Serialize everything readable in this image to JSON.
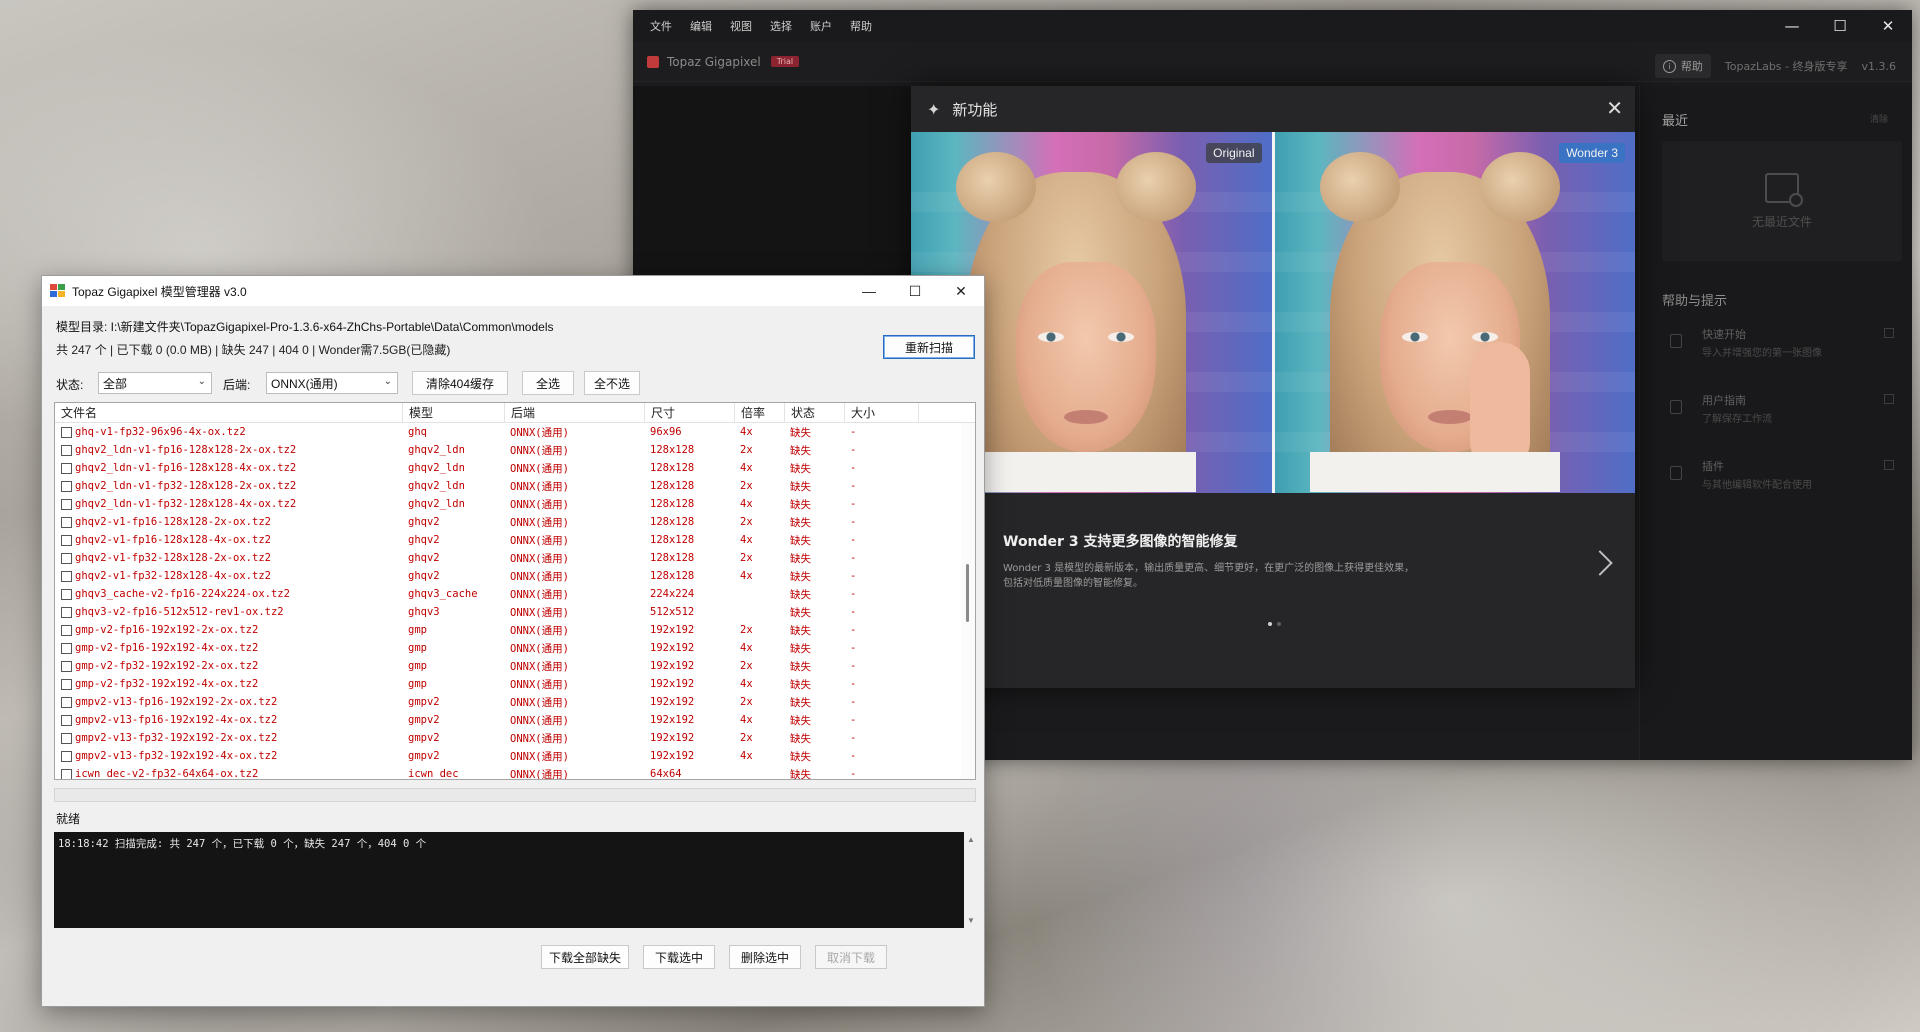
{
  "topaz": {
    "menu": [
      "文件",
      "编辑",
      "视图",
      "选择",
      "账户",
      "帮助"
    ],
    "brand": "Topaz Gigapixel",
    "badge": "Trial",
    "help_label": "帮助",
    "account_text": "TopazLabs - 终身版专享",
    "version": "v1.3.6",
    "recent_title": "最近",
    "recent_clear": "清除",
    "no_recent": "无最近文件",
    "tips_title": "帮助与提示",
    "tips": [
      {
        "title": "快速开始",
        "sub": "导入并增强您的第一张图像"
      },
      {
        "title": "用户指南",
        "sub": "了解保存工作流"
      },
      {
        "title": "插件",
        "sub": "与其他编辑软件配合使用"
      }
    ]
  },
  "whats_new": {
    "title": "新功能",
    "tag_left": "Original",
    "tag_right": "Wonder 3",
    "heading": "Wonder 3 支持更多图像的智能修复",
    "desc_line1": "Wonder 3 是模型的最新版本，输出质量更高、细节更好，在更广泛的图像上获得更佳效果，",
    "desc_line2": "包括对低质量图像的智能修复。",
    "page_count": 2,
    "active_page": 0
  },
  "manager": {
    "title": "Topaz Gigapixel 模型管理器 v3.0",
    "model_dir": "模型目录: I:\\新建文件夹\\TopazGigapixel-Pro-1.3.6-x64-ZhChs-Portable\\Data\\Common\\models",
    "stats": "共 247 个 | 已下载 0  (0.0 MB)   | 缺失 247 | 404 0 | Wonder需7.5GB(已隐藏)",
    "rescan_label": "重新扫描",
    "status_label": "状态:",
    "status_value": "全部",
    "backend_label": "后端:",
    "backend_value": "ONNX(通用)",
    "clear404_label": "清除404缓存",
    "select_all_label": "全选",
    "select_none_label": "全不选",
    "columns": [
      "文件名",
      "模型",
      "后端",
      "尺寸",
      "倍率",
      "状态",
      "大小"
    ],
    "rows": [
      [
        "ghq-v1-fp32-96x96-4x-ox.tz2",
        "ghq",
        "ONNX(通用)",
        "96x96",
        "4x",
        "缺失",
        "-"
      ],
      [
        "ghqv2_ldn-v1-fp16-128x128-2x-ox.tz2",
        "ghqv2_ldn",
        "ONNX(通用)",
        "128x128",
        "2x",
        "缺失",
        "-"
      ],
      [
        "ghqv2_ldn-v1-fp16-128x128-4x-ox.tz2",
        "ghqv2_ldn",
        "ONNX(通用)",
        "128x128",
        "4x",
        "缺失",
        "-"
      ],
      [
        "ghqv2_ldn-v1-fp32-128x128-2x-ox.tz2",
        "ghqv2_ldn",
        "ONNX(通用)",
        "128x128",
        "2x",
        "缺失",
        "-"
      ],
      [
        "ghqv2_ldn-v1-fp32-128x128-4x-ox.tz2",
        "ghqv2_ldn",
        "ONNX(通用)",
        "128x128",
        "4x",
        "缺失",
        "-"
      ],
      [
        "ghqv2-v1-fp16-128x128-2x-ox.tz2",
        "ghqv2",
        "ONNX(通用)",
        "128x128",
        "2x",
        "缺失",
        "-"
      ],
      [
        "ghqv2-v1-fp16-128x128-4x-ox.tz2",
        "ghqv2",
        "ONNX(通用)",
        "128x128",
        "4x",
        "缺失",
        "-"
      ],
      [
        "ghqv2-v1-fp32-128x128-2x-ox.tz2",
        "ghqv2",
        "ONNX(通用)",
        "128x128",
        "2x",
        "缺失",
        "-"
      ],
      [
        "ghqv2-v1-fp32-128x128-4x-ox.tz2",
        "ghqv2",
        "ONNX(通用)",
        "128x128",
        "4x",
        "缺失",
        "-"
      ],
      [
        "ghqv3_cache-v2-fp16-224x224-ox.tz2",
        "ghqv3_cache",
        "ONNX(通用)",
        "224x224",
        "",
        "缺失",
        "-"
      ],
      [
        "ghqv3-v2-fp16-512x512-rev1-ox.tz2",
        "ghqv3",
        "ONNX(通用)",
        "512x512",
        "",
        "缺失",
        "-"
      ],
      [
        "gmp-v2-fp16-192x192-2x-ox.tz2",
        "gmp",
        "ONNX(通用)",
        "192x192",
        "2x",
        "缺失",
        "-"
      ],
      [
        "gmp-v2-fp16-192x192-4x-ox.tz2",
        "gmp",
        "ONNX(通用)",
        "192x192",
        "4x",
        "缺失",
        "-"
      ],
      [
        "gmp-v2-fp32-192x192-2x-ox.tz2",
        "gmp",
        "ONNX(通用)",
        "192x192",
        "2x",
        "缺失",
        "-"
      ],
      [
        "gmp-v2-fp32-192x192-4x-ox.tz2",
        "gmp",
        "ONNX(通用)",
        "192x192",
        "4x",
        "缺失",
        "-"
      ],
      [
        "gmpv2-v13-fp16-192x192-2x-ox.tz2",
        "gmpv2",
        "ONNX(通用)",
        "192x192",
        "2x",
        "缺失",
        "-"
      ],
      [
        "gmpv2-v13-fp16-192x192-4x-ox.tz2",
        "gmpv2",
        "ONNX(通用)",
        "192x192",
        "4x",
        "缺失",
        "-"
      ],
      [
        "gmpv2-v13-fp32-192x192-2x-ox.tz2",
        "gmpv2",
        "ONNX(通用)",
        "192x192",
        "2x",
        "缺失",
        "-"
      ],
      [
        "gmpv2-v13-fp32-192x192-4x-ox.tz2",
        "gmpv2",
        "ONNX(通用)",
        "192x192",
        "4x",
        "缺失",
        "-"
      ],
      [
        "icwn_dec-v2-fp32-64x64-ox.tz2",
        "icwn_dec",
        "ONNX(通用)",
        "64x64",
        "",
        "缺失",
        "-"
      ]
    ],
    "status_text": "就绪",
    "log": "18:18:42 扫描完成: 共 247 个，已下载 0 个，缺失 247 个，404 0 个",
    "buttons": {
      "download_all_missing": "下载全部缺失",
      "download_selected": "下载选中",
      "delete_selected": "删除选中",
      "cancel_download": "取消下载"
    }
  }
}
